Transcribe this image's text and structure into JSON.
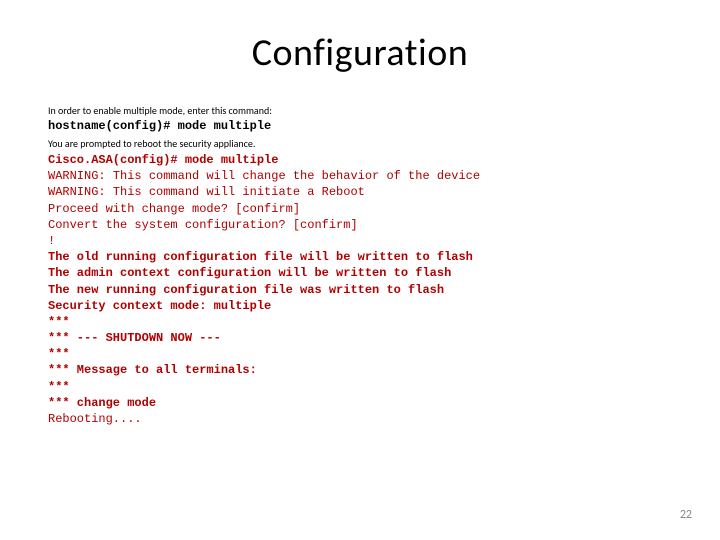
{
  "title": "Configuration",
  "intro1": "In order to enable multiple mode, enter this command:",
  "cmd1": "hostname(config)# mode multiple",
  "intro2": "You are prompted to reboot the security appliance.",
  "term": {
    "l1": "Cisco.ASA(config)# mode multiple",
    "l2": "WARNING: This command will change the behavior of the device",
    "l3": "WARNING: This command will initiate a Reboot",
    "l4": "Proceed with change mode? [confirm]",
    "l5": "Convert the system configuration? [confirm]",
    "l6": "!",
    "l7": "The old running configuration file will be written to flash",
    "l8": "The admin context configuration will be written to flash",
    "l9": "The new running configuration file was written to flash",
    "l10": "Security context mode: multiple",
    "l11": "***",
    "l12": "*** --- SHUTDOWN NOW ---",
    "l13": "***",
    "l14": "*** Message to all terminals:",
    "l15": "***",
    "l16": "*** change mode",
    "l17": "Rebooting...."
  },
  "pagenum": "22"
}
